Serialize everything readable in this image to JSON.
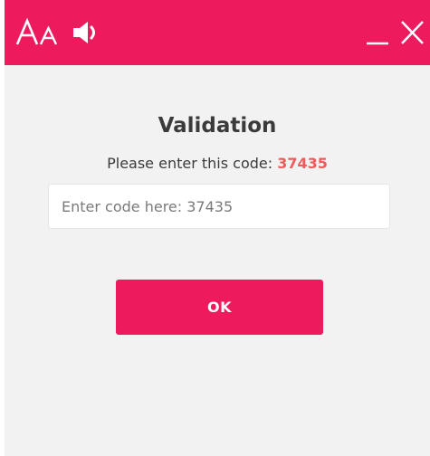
{
  "titlebar": {
    "font_size_label": "Aᴀ",
    "icons": {
      "font_size": "font-size-icon",
      "speaker": "speaker-icon",
      "minimize": "minimize-icon",
      "close": "close-icon"
    }
  },
  "dialog": {
    "title": "Validation",
    "instruction_prefix": "Please enter this code: ",
    "code": "37435",
    "input": {
      "value": "",
      "placeholder": "Enter code here: 37435"
    },
    "ok_label": "OK"
  },
  "colors": {
    "accent": "#ee1a5e",
    "code_highlight": "#f05a5a",
    "background": "#f2f2f2",
    "text": "#3b3b3b"
  }
}
